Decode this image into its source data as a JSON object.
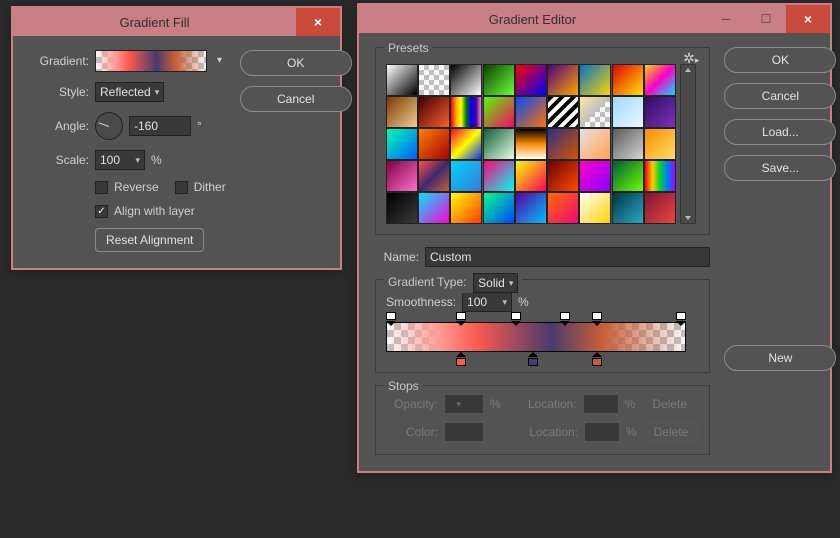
{
  "fill": {
    "title": "Gradient Fill",
    "labels": {
      "gradient": "Gradient:",
      "style": "Style:",
      "angle": "Angle:",
      "scale": "Scale:",
      "reverse": "Reverse",
      "dither": "Dither",
      "align": "Align with layer",
      "deg": "°",
      "pct": "%"
    },
    "values": {
      "style": "Reflected",
      "angle": "-160",
      "scale": "100",
      "reverse": false,
      "dither": false,
      "align": true
    },
    "buttons": {
      "ok": "OK",
      "cancel": "Cancel",
      "reset": "Reset Alignment"
    }
  },
  "editor": {
    "title": "Gradient Editor",
    "buttons": {
      "ok": "OK",
      "cancel": "Cancel",
      "load": "Load...",
      "save": "Save...",
      "new": "New",
      "delete": "Delete"
    },
    "labels": {
      "presets": "Presets",
      "name": "Name:",
      "gradient_type": "Gradient Type:",
      "smoothness": "Smoothness:",
      "pct": "%",
      "stops": "Stops",
      "opacity": "Opacity:",
      "color": "Color:",
      "location": "Location:"
    },
    "values": {
      "name": "Custom",
      "gradient_type": "Solid",
      "smoothness": "100"
    },
    "opacity_stops": [
      {
        "pos": 0
      },
      {
        "pos": 24
      },
      {
        "pos": 43
      },
      {
        "pos": 60
      },
      {
        "pos": 71
      },
      {
        "pos": 100
      }
    ],
    "color_stops": [
      {
        "pos": 24,
        "color": "#fc5a4e"
      },
      {
        "pos": 49,
        "color": "#4a3b6c"
      },
      {
        "pos": 71,
        "color": "#c65e39"
      }
    ],
    "presets": [
      "linear-gradient(135deg,#fff,#000)",
      "repeating-conic-gradient(#c0c0c0 0 25%,#f8f8f8 0 50%) 0 0/10px 10px",
      "linear-gradient(135deg,#000,#fff)",
      "linear-gradient(135deg,#0a4000,#6dff3a)",
      "linear-gradient(135deg,#ff0000,#0000ff)",
      "linear-gradient(135deg,#4a007f,#ffa500)",
      "linear-gradient(135deg,#0072c6,#ffd400)",
      "linear-gradient(135deg,#e40000,#ffe600)",
      "linear-gradient(135deg,#ffd400,#ff00c8,#00e0ff)",
      "linear-gradient(135deg,#7a3b00,#f3cc92)",
      "linear-gradient(135deg,#3c0000,#ff5e2e)",
      "linear-gradient(90deg,red,orange,yellow,green,blue,indigo,violet)",
      "linear-gradient(135deg,#52ff00,#ff0066)",
      "linear-gradient(135deg,#004cff,#ff7000)",
      "repeating-linear-gradient(135deg,#000 0 4px,#fff 4px 8px)",
      "linear-gradient(135deg,#ffe7a0,#c0c0c0 50%,transparent 50%),repeating-conic-gradient(#c0c0c0 0 25%,#f8f8f8 0 50%) 0 0/10px 10px",
      "linear-gradient(135deg,#9fd8ff,#eaf7ff)",
      "linear-gradient(135deg,#2b0f5e,#7e2fbf)",
      "linear-gradient(135deg,#00ffb3,#005eff)",
      "linear-gradient(135deg,#ff8100,#a60000)",
      "linear-gradient(135deg,#ff0033,#ffff00,#0033ff)",
      "linear-gradient(135deg,#0b5e3a,#e8ffe0)",
      "linear-gradient(180deg,#000,#ff8c00,#ffffff)",
      "linear-gradient(135deg,#2e2e86,#d35400)",
      "linear-gradient(135deg,#e9e0e0,#ffa44d)",
      "linear-gradient(135deg,#5a5a5a,#d4d4d4)",
      "linear-gradient(135deg,#ff8a00,#ffe066)",
      "linear-gradient(135deg,#7f003f,#ff71ce)",
      "linear-gradient(135deg,#ff4f4f,#3f2a6b,#c65e39)",
      "linear-gradient(135deg,#00d2ff,#3a7bd5)",
      "linear-gradient(135deg,#ff0080,#00fff0)",
      "linear-gradient(135deg,#f6ff00,#ff005c)",
      "linear-gradient(135deg,#6b0000,#ff4d00)",
      "linear-gradient(135deg,#ff00c8,#8800ff)",
      "linear-gradient(135deg,#005c36,#6fff00)",
      "linear-gradient(90deg,#ff0000,#ffcc00,#00d62f,#007bff,#a500ff)",
      "linear-gradient(135deg,#000,#3a3a3a)",
      "linear-gradient(135deg,#00e5ff,#ff00d4)",
      "linear-gradient(135deg,#fffb00,#ff3b00)",
      "linear-gradient(135deg,#00ff88,#0044ff)",
      "linear-gradient(135deg,#5700a3,#00c2ff)",
      "linear-gradient(135deg,#ff6a00,#ee0979)",
      "linear-gradient(135deg,#ffffff,#ffd400)",
      "linear-gradient(135deg,#00353f,#2aa9c9)",
      "linear-gradient(135deg,#801336,#ee4540)"
    ]
  }
}
